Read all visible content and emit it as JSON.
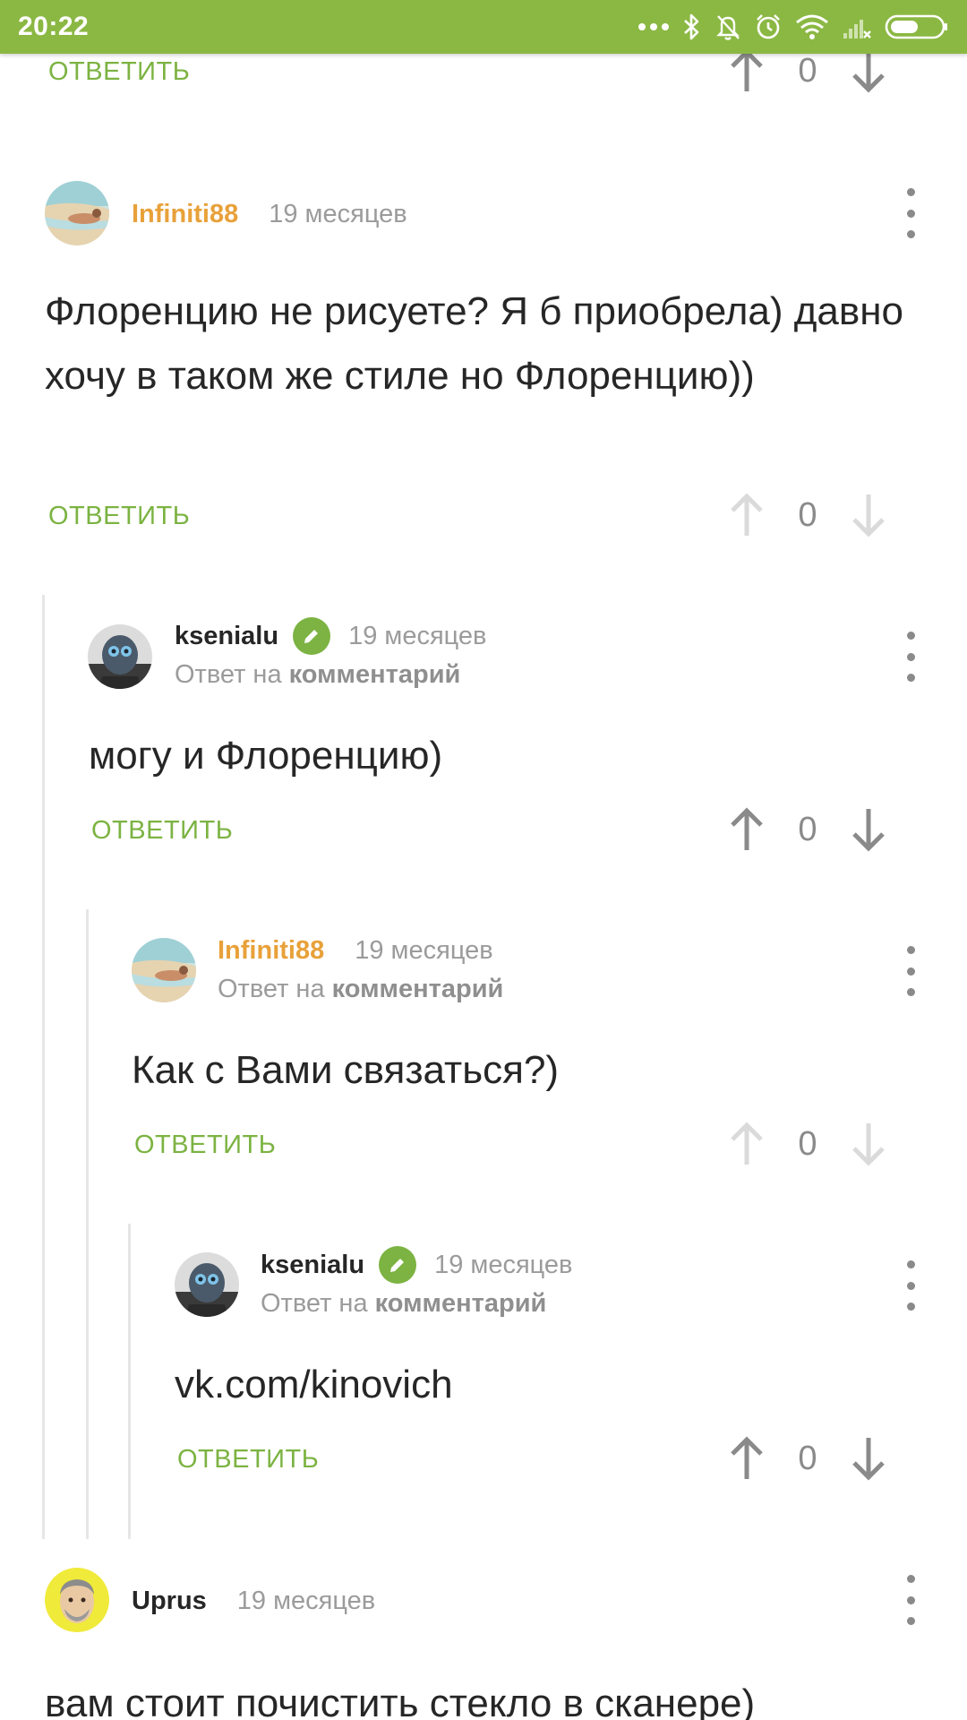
{
  "status_bar": {
    "time": "20:22",
    "icons": [
      "more-dots-icon",
      "bluetooth-icon",
      "mute-icon",
      "alarm-icon",
      "wifi-icon",
      "signal-icon",
      "battery-icon"
    ]
  },
  "colors": {
    "status_bar": "#8bb843",
    "accent_green": "#7cb342",
    "author_orange": "#e8a13a",
    "muted_gray": "#9b9b9b"
  },
  "top_actions": {
    "reply_label": "ОТВЕТИТЬ",
    "score": "0"
  },
  "comments": [
    {
      "author": "Infiniti88",
      "time": "19 месяцев",
      "text": "Флоренцию не рисуете? Я б приобрела) давно хочу в таком же стиле но Флоренцию))",
      "reply_label": "ОТВЕТИТЬ",
      "score": "0"
    },
    {
      "author": "ksenialu",
      "time": "19 месяцев",
      "reply_prefix": "Ответ на",
      "reply_target": "комментарий",
      "text": "могу и Флоренцию)",
      "reply_label": "ОТВЕТИТЬ",
      "score": "0"
    },
    {
      "author": "Infiniti88",
      "time": "19 месяцев",
      "reply_prefix": "Ответ на",
      "reply_target": "комментарий",
      "text": "Как с Вами связаться?)",
      "reply_label": "ОТВЕТИТЬ",
      "score": "0"
    },
    {
      "author": "ksenialu",
      "time": "19 месяцев",
      "reply_prefix": "Ответ на",
      "reply_target": "комментарий",
      "text": "vk.com/kinovich",
      "reply_label": "ОТВЕТИТЬ",
      "score": "0"
    },
    {
      "author": "Uprus",
      "time": "19 месяцев",
      "text": "вам стоит почистить стекло в сканере)"
    }
  ]
}
